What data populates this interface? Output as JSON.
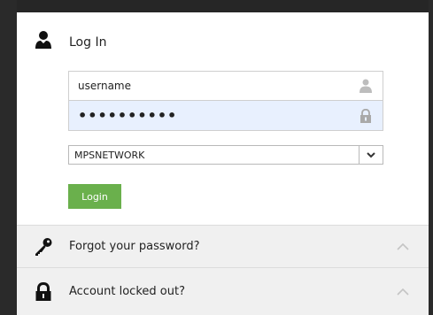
{
  "login": {
    "title": "Log In",
    "username_value": "username",
    "password_value": "••••••••••",
    "domain_selected": "MPSNETWORK",
    "login_button": "Login"
  },
  "accordion": {
    "forgot_label": "Forgot your password?",
    "locked_label": "Account locked out?"
  },
  "colors": {
    "accent_green": "#6ab04c",
    "autofill_bg": "#e8f0fe",
    "row_bg": "#f0f0f0"
  },
  "icons": {
    "header": "user-icon",
    "username_field": "user-icon",
    "password_field": "lock-icon",
    "forgot": "key-icon",
    "locked": "lock-icon",
    "dropdown": "chevron-down-icon",
    "collapse": "chevron-up-icon"
  }
}
